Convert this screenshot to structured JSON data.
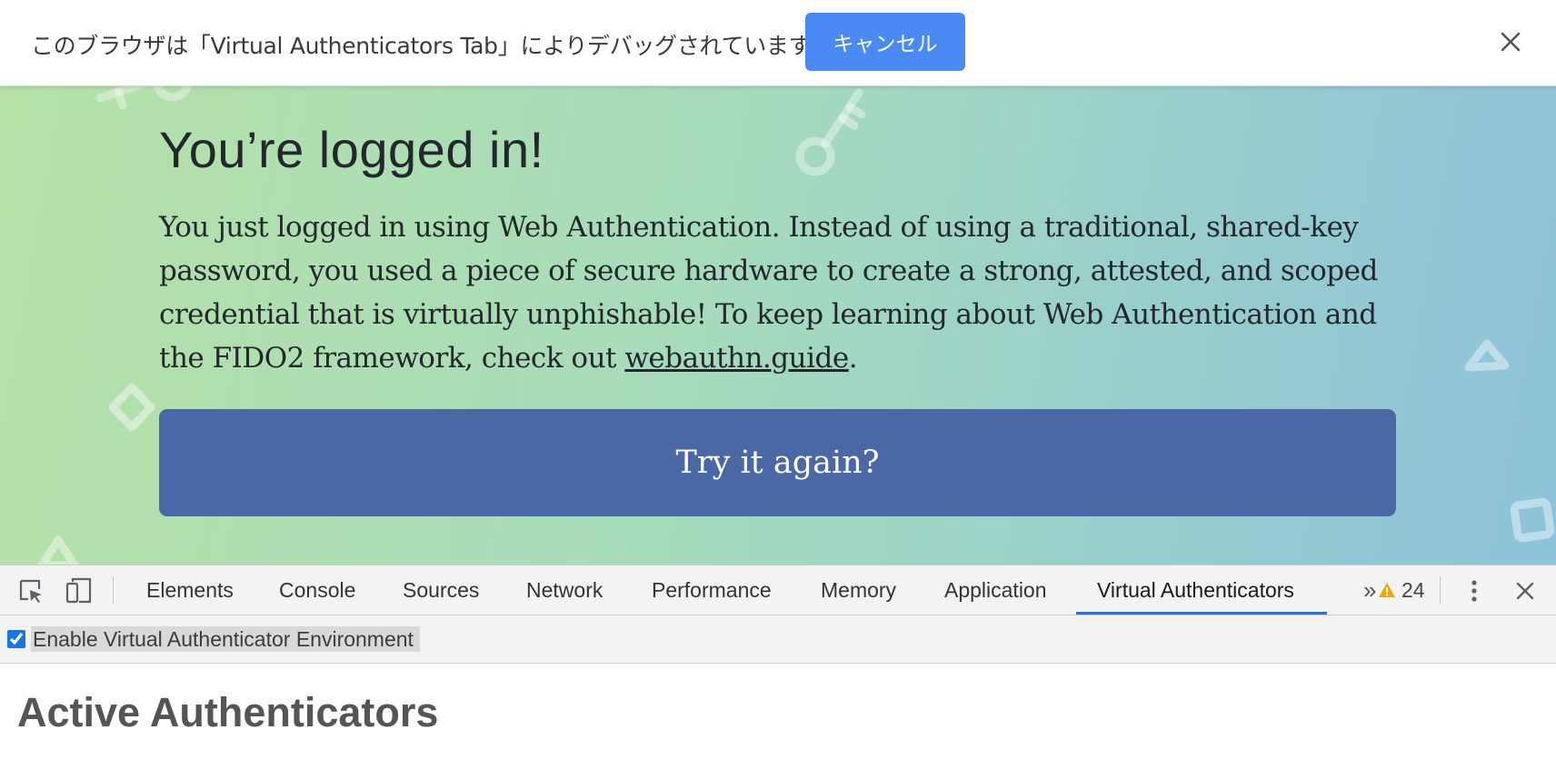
{
  "infobar": {
    "message": "このブラウザは「Virtual Authenticators Tab」によりデバッグされています",
    "cancel_label": "キャンセル",
    "close_icon": "close-icon"
  },
  "page": {
    "title": "You’re logged in!",
    "body_text": "You just logged in using Web Authentication. Instead of using a traditional, shared-key password, you used a piece of secure hardware to create a strong, attested, and scoped credential that is virtually unphishable! To keep learning about Web Authentication and the FIDO2 framework, check out ",
    "link_text": "webauthn.guide",
    "body_end": ".",
    "try_again_label": "Try it again?",
    "colors": {
      "button": "#4a67a6",
      "gradient_start": "#b6e2a7",
      "gradient_end": "#8dc3d9"
    }
  },
  "devtools": {
    "tabs": [
      {
        "label": "Elements"
      },
      {
        "label": "Console"
      },
      {
        "label": "Sources"
      },
      {
        "label": "Network"
      },
      {
        "label": "Performance"
      },
      {
        "label": "Memory"
      },
      {
        "label": "Application"
      },
      {
        "label": "Virtual Authenticators",
        "active": true
      }
    ],
    "more_tabs_label": "»",
    "warning_count": "24",
    "accent_color": "#1a73e8",
    "enable_env_label": "Enable Virtual Authenticator Environment",
    "enable_env_checked": true,
    "active_heading": "Active Authenticators"
  }
}
